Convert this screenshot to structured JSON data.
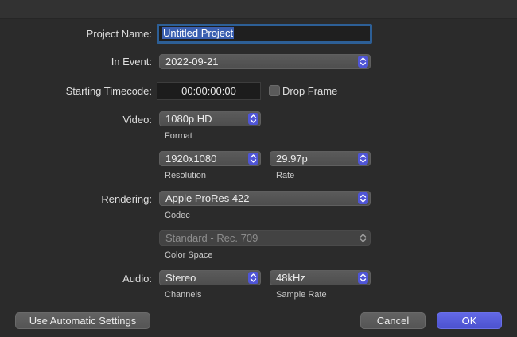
{
  "labels": {
    "project_name": "Project Name:",
    "in_event": "In Event:",
    "starting_timecode": "Starting Timecode:",
    "video": "Video:",
    "rendering": "Rendering:",
    "audio": "Audio:"
  },
  "project_name": {
    "value": "Untitled Project"
  },
  "in_event": {
    "value": "2022-09-21"
  },
  "timecode": {
    "value": "00:00:00:00"
  },
  "drop_frame": {
    "label": "Drop Frame",
    "checked": false
  },
  "video": {
    "format": {
      "value": "1080p HD",
      "caption": "Format"
    },
    "resolution": {
      "value": "1920x1080",
      "caption": "Resolution"
    },
    "rate": {
      "value": "29.97p",
      "caption": "Rate"
    }
  },
  "rendering": {
    "codec": {
      "value": "Apple ProRes 422",
      "caption": "Codec"
    },
    "color_space": {
      "value": "Standard - Rec. 709",
      "caption": "Color Space"
    }
  },
  "audio": {
    "channels": {
      "value": "Stereo",
      "caption": "Channels"
    },
    "sample_rate": {
      "value": "48kHz",
      "caption": "Sample Rate"
    }
  },
  "buttons": {
    "automatic": "Use Automatic Settings",
    "cancel": "Cancel",
    "ok": "OK"
  },
  "colors": {
    "background": "#2b2b2b",
    "accent": "#4f55d6",
    "focus_ring": "#2d5f96",
    "selection": "#3a5fb0"
  },
  "icons": {
    "popup_stepper": "up-down-chevron-icon"
  }
}
